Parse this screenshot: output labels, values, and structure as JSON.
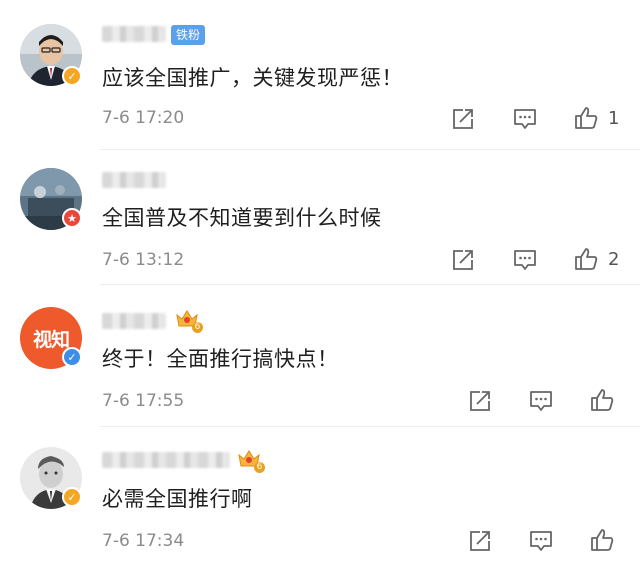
{
  "comments": [
    {
      "fan_tag": "铁粉",
      "text": "应该全国推广，关键发现严惩！",
      "time": "7-6 17:20",
      "likes": "1",
      "badge_color": "#f5a623"
    },
    {
      "text": "全国普及不知道要到什么时候",
      "time": "7-6 13:12",
      "likes": "2",
      "badge_color": "#e8483a"
    },
    {
      "avatar_text": "视知",
      "text": "终于！全面推行搞快点！",
      "time": "7-6 17:55",
      "badge_color": "#3c8ee8",
      "crown_level": "6"
    },
    {
      "text": "必需全国推行啊",
      "time": "7-6 17:34",
      "badge_color": "#f5a623",
      "crown_level": "6"
    }
  ],
  "icons": {
    "share": "share-icon",
    "comment": "comment-icon",
    "like": "thumbs-up-icon"
  }
}
